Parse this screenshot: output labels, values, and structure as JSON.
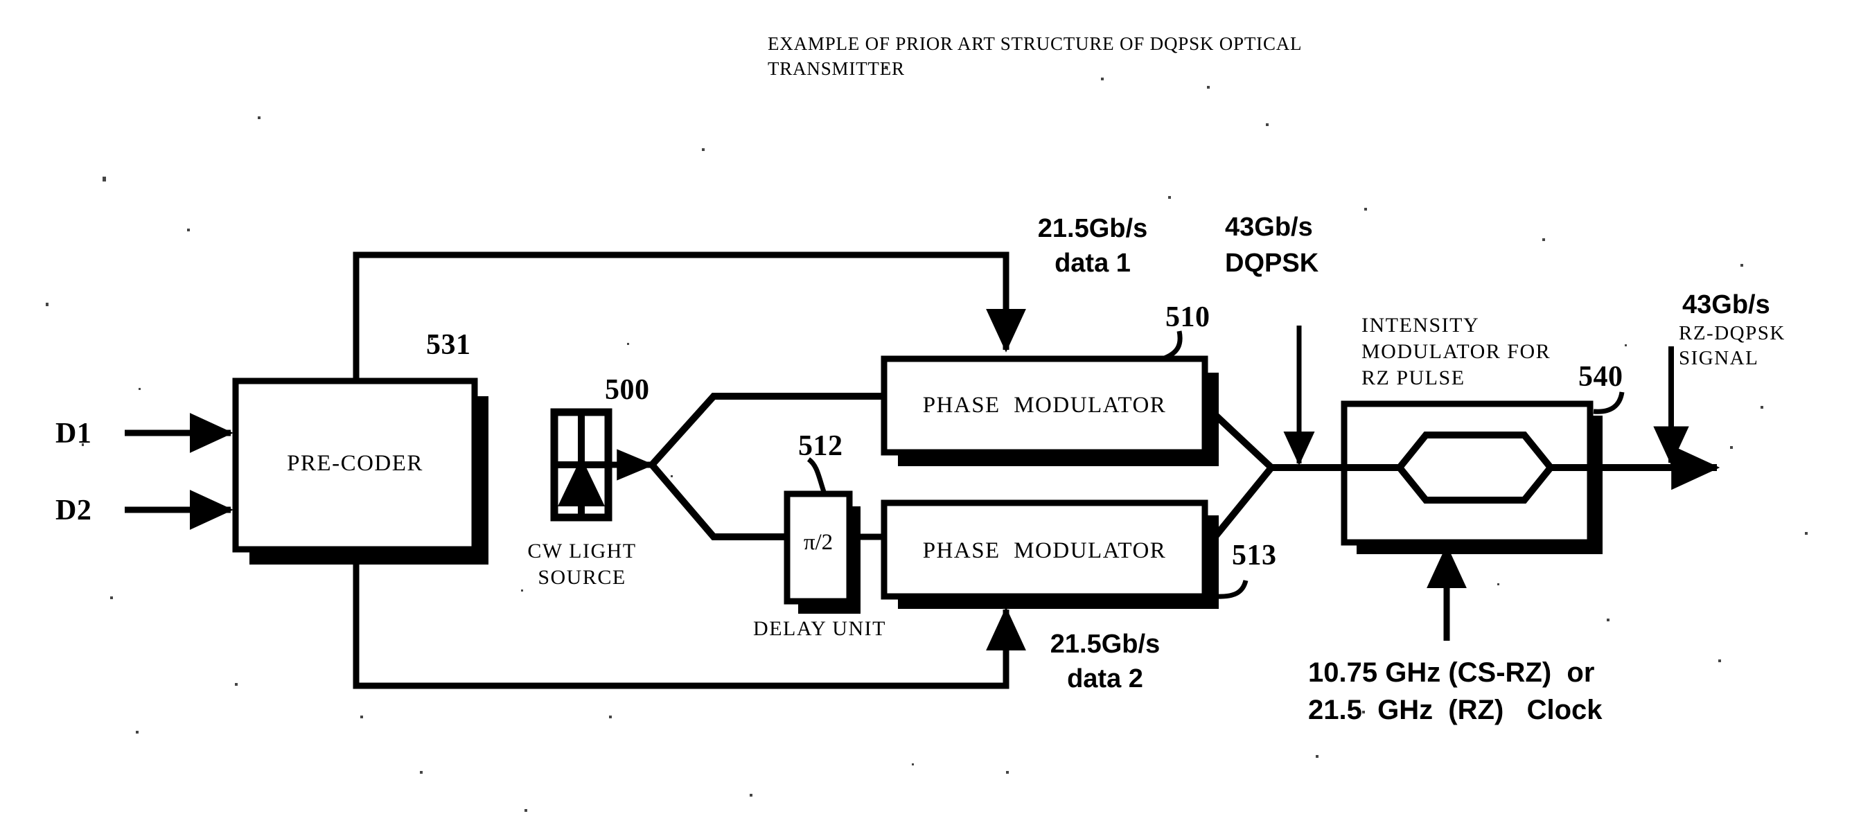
{
  "figure": {
    "title_line_1": "EXAMPLE OF PRIOR ART STRUCTURE OF DQPSK OPTICAL",
    "title_line_2": "TRANSMITTER"
  },
  "inputs": {
    "d1": "D1",
    "d2": "D2"
  },
  "blocks": {
    "precoder": {
      "label": "PRE-CODER",
      "ref": "531"
    },
    "cw_source": {
      "label_line_1": "CW LIGHT",
      "label_line_2": "SOURCE",
      "ref": "500"
    },
    "delay_unit": {
      "label": "DELAY UNIT",
      "value": "π/2",
      "ref": "512"
    },
    "phase_modulator_upper": {
      "label": "PHASE  MODULATOR",
      "ref": "510"
    },
    "phase_modulator_lower": {
      "label": "PHASE  MODULATOR",
      "ref": "513"
    },
    "intensity_modulator": {
      "label_line_1": "INTENSITY",
      "label_line_2": "MODULATOR FOR",
      "label_line_3": "RZ PULSE",
      "ref": "540"
    }
  },
  "annotations": {
    "data1": {
      "rate": "21.5Gb/s",
      "name": "data 1"
    },
    "data2": {
      "rate": "21.5Gb/s",
      "name": "data 2"
    },
    "dqpsk_mid": {
      "rate": "43Gb/s",
      "name": "DQPSK"
    },
    "output": {
      "rate": "43Gb/s",
      "name_line_1": "RZ-DQPSK",
      "name_line_2": "SIGNAL"
    },
    "clock": {
      "line_1": "10.75 GHz (CS-RZ)  or",
      "line_2": "21.5  GHz  (RZ)   Clock"
    }
  },
  "colors": {
    "ink": "#000000",
    "paper": "#ffffff"
  }
}
